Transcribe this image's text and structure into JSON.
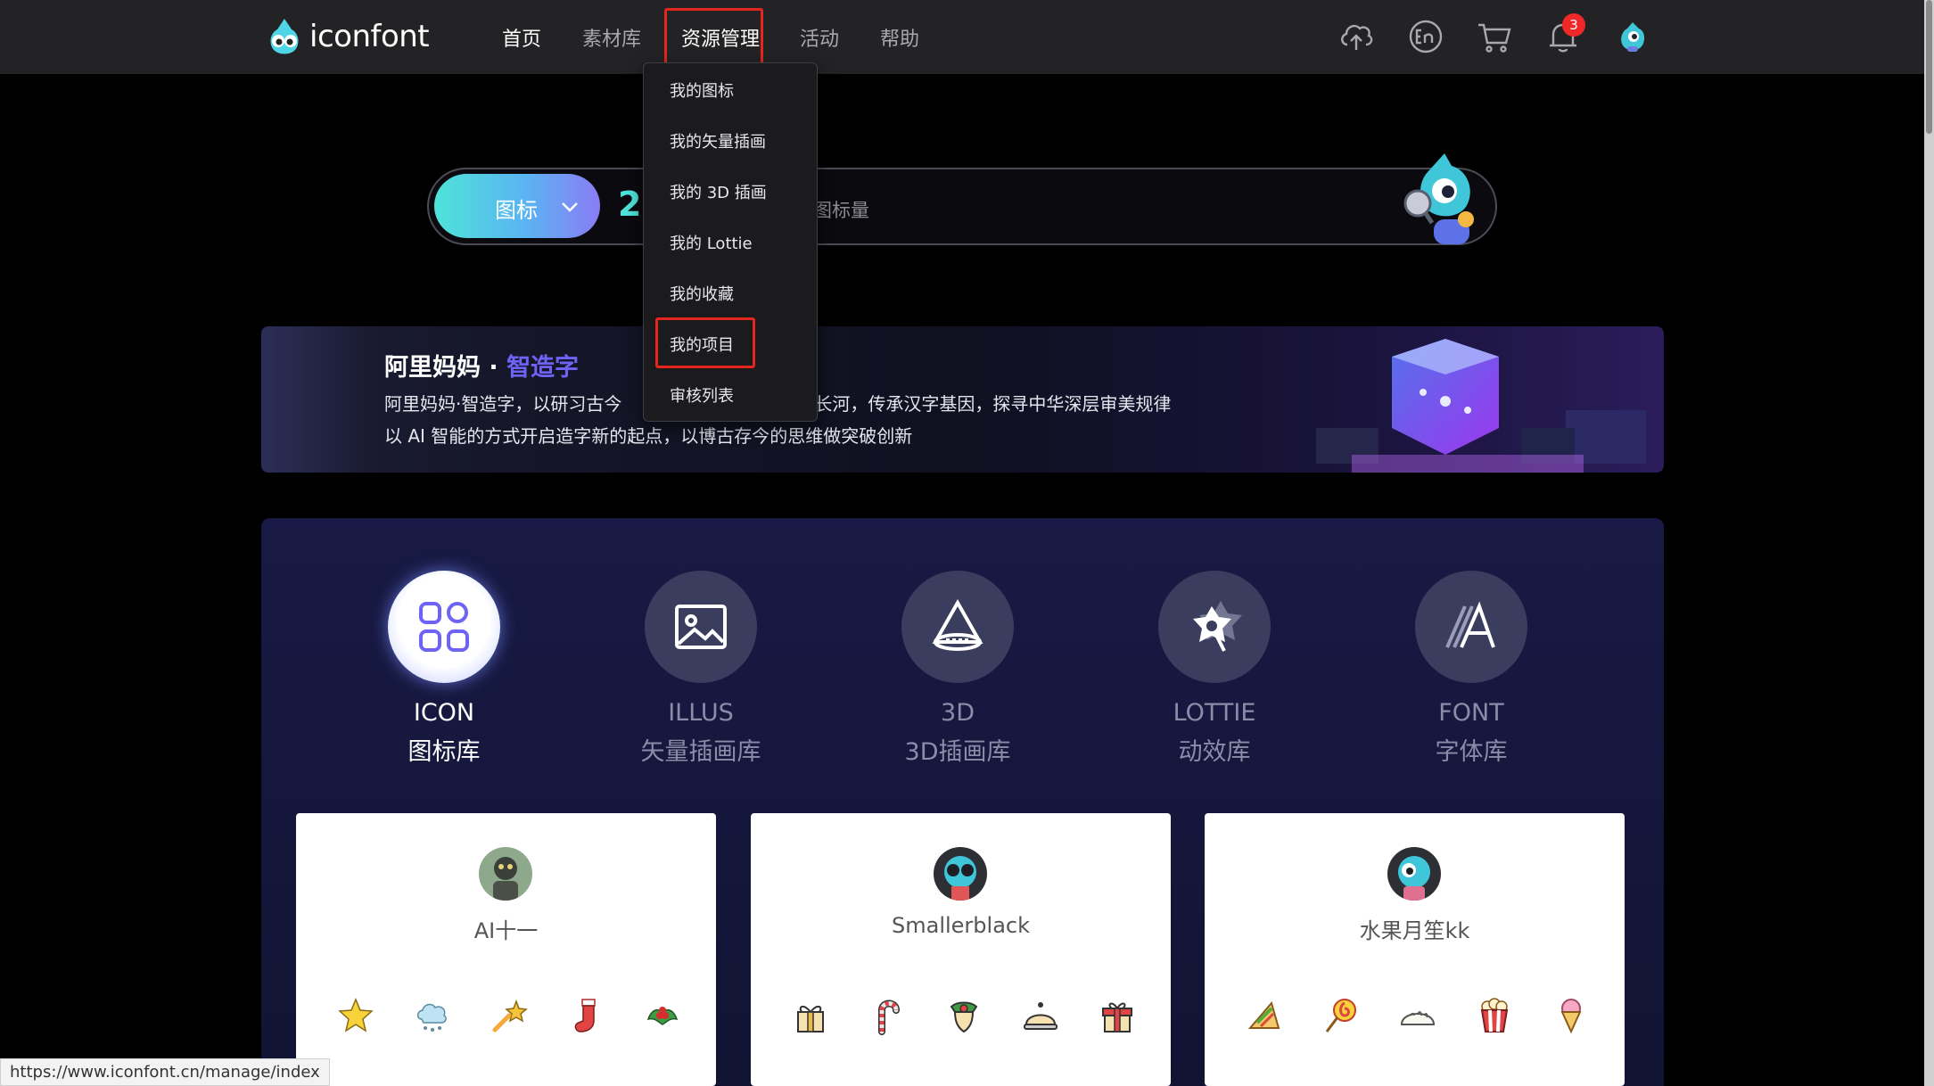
{
  "nav": {
    "logo_text": "iconfont",
    "items": [
      "首页",
      "素材库",
      "资源管理",
      "活动",
      "帮助"
    ],
    "notification_count": "3",
    "icons": [
      "upload-cloud-icon",
      "language-en-icon",
      "cart-icon",
      "bell-icon",
      "user-avatar-icon"
    ],
    "colors": {
      "bar": "#232326",
      "highlight": "#e5261e"
    }
  },
  "dropdown": {
    "items": [
      "我的图标",
      "我的矢量插画",
      "我的 3D 插画",
      "我的 Lottie",
      "我的收藏",
      "我的项目",
      "审核列表"
    ],
    "highlighted": "我的项目"
  },
  "search": {
    "type_label": "图标",
    "count_prefix": "2",
    "placeholder_suffix": "图标量"
  },
  "banner": {
    "title_main": "阿里妈妈",
    "title_dot": " · ",
    "title_accent": "智造字",
    "desc_line1_a": "阿里妈妈·智造字，以研习古今",
    "desc_line1_b": "史长河，传承汉字基因，探寻中华深层审美规律",
    "desc_line2": "以 AI 智能的方式开启造字新的起点，以博古存今的思维做突破创新",
    "accent_color": "#6e63f6"
  },
  "categories": [
    {
      "en": "ICON",
      "cn": "图标库",
      "icon": "grid-icon",
      "active": true
    },
    {
      "en": "ILLUS",
      "cn": "矢量插画库",
      "icon": "image-icon",
      "active": false
    },
    {
      "en": "3D",
      "cn": "3D插画库",
      "icon": "cone-3d-icon",
      "active": false
    },
    {
      "en": "LOTTIE",
      "cn": "动效库",
      "icon": "lottie-star-icon",
      "active": false
    },
    {
      "en": "FONT",
      "cn": "字体库",
      "icon": "font-a-icon",
      "active": false
    }
  ],
  "cards": [
    {
      "name": "AI十一",
      "icons": [
        "star-icon",
        "snow-cloud-icon",
        "shooting-star-icon",
        "stocking-icon",
        "holly-icon"
      ]
    },
    {
      "name": "Smallerblack",
      "icons": [
        "gift-bow-icon",
        "candy-cane-icon",
        "christmas-bell-icon",
        "cloche-icon",
        "gift-box-icon"
      ]
    },
    {
      "name": "水果月笙kk",
      "icons": [
        "sandwich-icon",
        "lollipop-icon",
        "dumpling-icon",
        "popcorn-icon",
        "ice-cream-icon"
      ]
    }
  ],
  "status_url": "https://www.iconfont.cn/manage/index"
}
